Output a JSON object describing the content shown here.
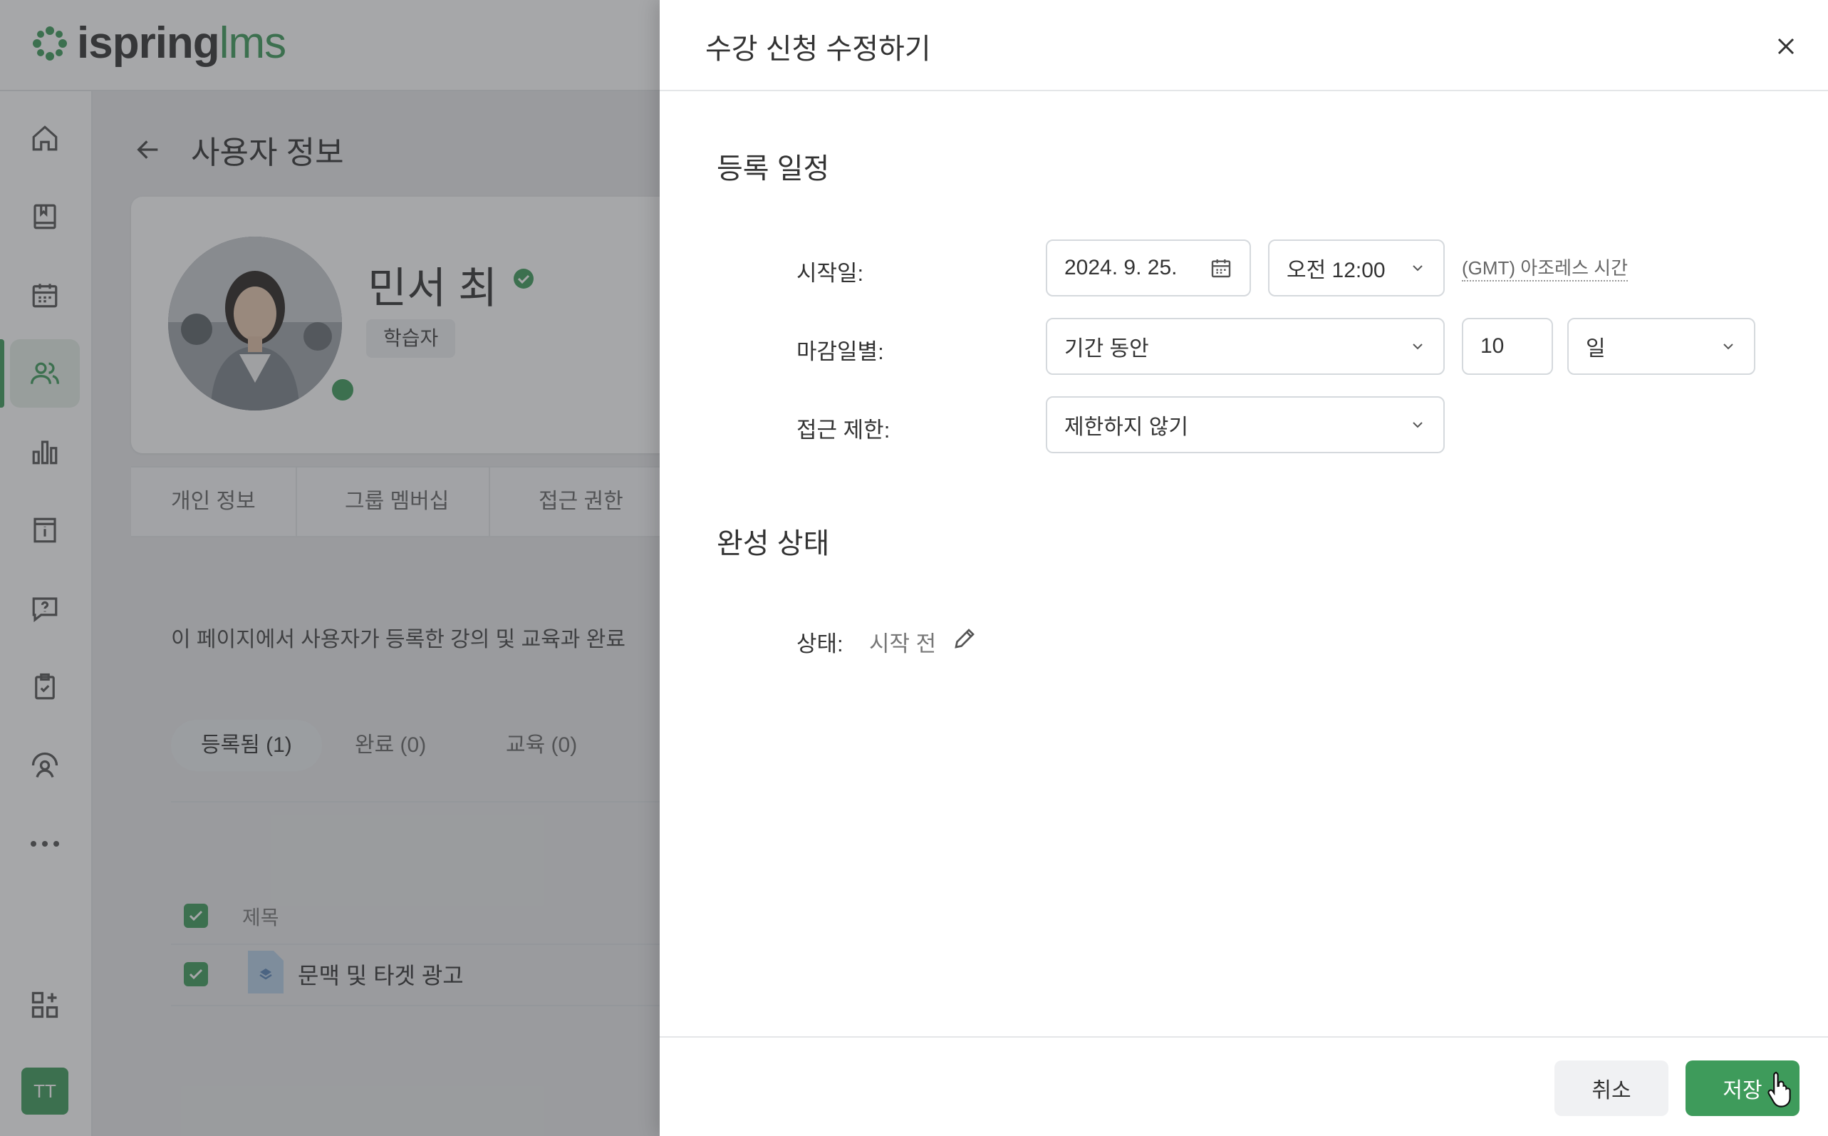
{
  "app": {
    "logo_text_main": "ispring",
    "logo_text_accent": "lms",
    "brand_color": "#3e9b5b"
  },
  "sidebar": {
    "items": [
      {
        "name": "home",
        "icon": "home-icon"
      },
      {
        "name": "courses",
        "icon": "book-icon"
      },
      {
        "name": "calendar",
        "icon": "calendar-icon"
      },
      {
        "name": "users",
        "icon": "users-icon",
        "active": true
      },
      {
        "name": "reports",
        "icon": "bar-chart-icon"
      },
      {
        "name": "info",
        "icon": "info-icon"
      },
      {
        "name": "help",
        "icon": "question-icon"
      },
      {
        "name": "tasks",
        "icon": "clipboard-check-icon"
      },
      {
        "name": "roles",
        "icon": "user-gauge-icon"
      },
      {
        "name": "more",
        "icon": "more-icon"
      }
    ],
    "add_apps_icon": "add-apps-icon",
    "user_initials": "TT"
  },
  "page": {
    "title": "사용자 정보",
    "user": {
      "name": "민서 최",
      "role": "학습자"
    },
    "tabs": [
      "개인 정보",
      "그룹 멤버십",
      "접근 권한"
    ],
    "description": "이 페이지에서 사용자가 등록한 강의 및 교육과 완료",
    "filters": [
      "등록됨 (1)",
      "완료 (0)",
      "교육 (0)"
    ],
    "table": {
      "column_title": "제목",
      "rows": [
        {
          "title": "문맥 및 타겟 광고"
        }
      ]
    }
  },
  "dialog": {
    "title": "수강 신청 수정하기",
    "schedule": {
      "section_title": "등록 일정",
      "start_label": "시작일:",
      "start_date": "2024. 9. 25.",
      "start_time": "오전 12:00",
      "timezone": "(GMT) 아조레스 시간",
      "due_label": "마감일별:",
      "due_mode": "기간 동안",
      "due_amount": "10",
      "due_unit": "일",
      "access_label": "접근 제한:",
      "access_value": "제한하지 않기"
    },
    "completion": {
      "section_title": "완성 상태",
      "status_label": "상태:",
      "status_value": "시작 전"
    },
    "buttons": {
      "cancel": "취소",
      "save": "저장"
    }
  }
}
